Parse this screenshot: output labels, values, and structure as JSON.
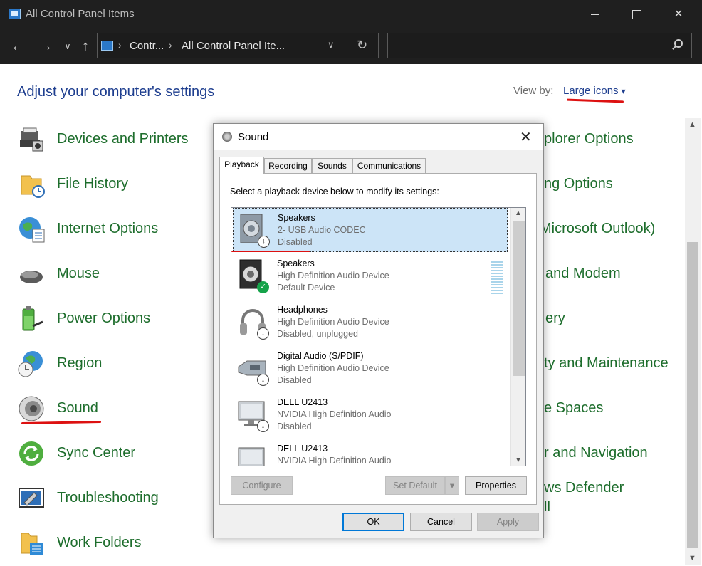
{
  "window": {
    "title": "All Control Panel Items"
  },
  "address": {
    "crumbs": [
      "Contr...",
      "All Control Panel Ite..."
    ],
    "search_placeholder": ""
  },
  "header": {
    "heading": "Adjust your computer's settings",
    "view_by_label": "View by:",
    "view_by_value": "Large icons"
  },
  "left_items": [
    {
      "label": "Devices and Printers",
      "icon": "devices-printers-icon"
    },
    {
      "label": "File History",
      "icon": "file-history-icon"
    },
    {
      "label": "Internet Options",
      "icon": "internet-options-icon"
    },
    {
      "label": "Mouse",
      "icon": "mouse-icon"
    },
    {
      "label": "Power Options",
      "icon": "power-options-icon"
    },
    {
      "label": "Region",
      "icon": "region-icon"
    },
    {
      "label": "Sound",
      "icon": "sound-icon"
    },
    {
      "label": "Sync Center",
      "icon": "sync-center-icon"
    },
    {
      "label": "Troubleshooting",
      "icon": "troubleshooting-icon"
    },
    {
      "label": "Work Folders",
      "icon": "work-folders-icon"
    }
  ],
  "right_items_partial": [
    "plorer Options",
    "ng Options",
    "Microsoft Outlook)",
    "and Modem",
    "ery",
    "ty and Maintenance",
    "e Spaces",
    "r and Navigation",
    "ws Defender",
    "ll"
  ],
  "dialog": {
    "title": "Sound",
    "tabs": [
      "Playback",
      "Recording",
      "Sounds",
      "Communications"
    ],
    "active_tab": "Playback",
    "prompt": "Select a playback device below to modify its settings:",
    "devices": [
      {
        "name": "Speakers",
        "desc": "2- USB Audio CODEC",
        "status": "Disabled",
        "icon": "speaker-icon",
        "state": "disabled",
        "selected": true
      },
      {
        "name": "Speakers",
        "desc": "High Definition Audio Device",
        "status": "Default Device",
        "icon": "speaker-icon",
        "state": "default",
        "selected": false
      },
      {
        "name": "Headphones",
        "desc": "High Definition Audio Device",
        "status": "Disabled, unplugged",
        "icon": "headphones-icon",
        "state": "disabled",
        "selected": false
      },
      {
        "name": "Digital Audio (S/PDIF)",
        "desc": "High Definition Audio Device",
        "status": "Disabled",
        "icon": "digital-audio-icon",
        "state": "disabled",
        "selected": false
      },
      {
        "name": "DELL U2413",
        "desc": "NVIDIA High Definition Audio",
        "status": "Disabled",
        "icon": "monitor-icon",
        "state": "disabled",
        "selected": false
      },
      {
        "name": "DELL U2413",
        "desc": "NVIDIA High Definition Audio",
        "status": "",
        "icon": "monitor-icon",
        "state": "disabled",
        "selected": false
      }
    ],
    "buttons": {
      "configure": "Configure",
      "set_default": "Set Default",
      "properties": "Properties",
      "ok": "OK",
      "cancel": "Cancel",
      "apply": "Apply"
    }
  },
  "colors": {
    "link_green": "#1d6d2c",
    "heading_blue": "#1e3e8f",
    "annotation_red": "#dd1111",
    "selection": "#cce4f7"
  }
}
